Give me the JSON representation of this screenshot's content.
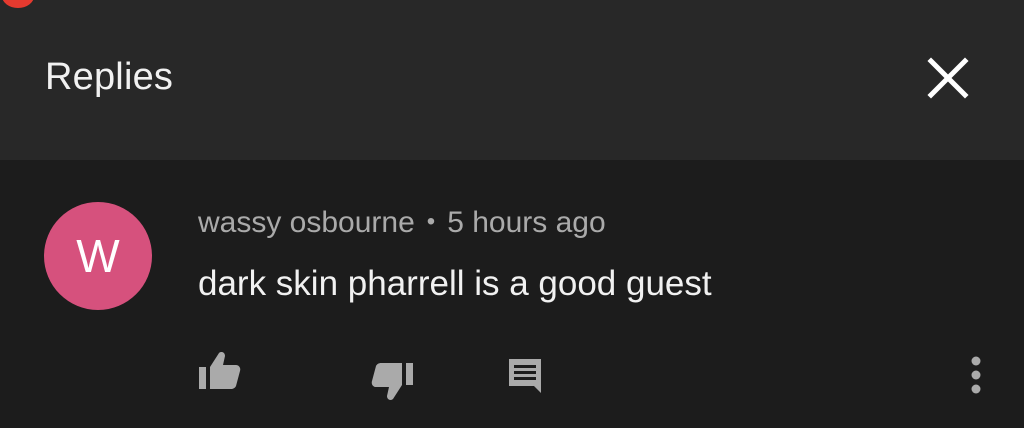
{
  "header": {
    "title": "Replies"
  },
  "comment": {
    "avatar_letter": "W",
    "author": "wassy osbourne",
    "separator": "•",
    "time": "5 hours ago",
    "text": "dark skin pharrell is a good guest"
  },
  "icons": {
    "close": "close-icon",
    "like": "thumbs-up-icon",
    "dislike": "thumbs-down-icon",
    "reply": "comment-reply-icon",
    "more": "more-vertical-icon"
  },
  "colors": {
    "background": "#1c1c1c",
    "header_background": "#282828",
    "avatar": "#d6517d",
    "notification_dot": "#e53a2f",
    "primary_text": "#f1f1f1",
    "secondary_text": "#aaaaaa",
    "icon": "#aaaaaa"
  }
}
